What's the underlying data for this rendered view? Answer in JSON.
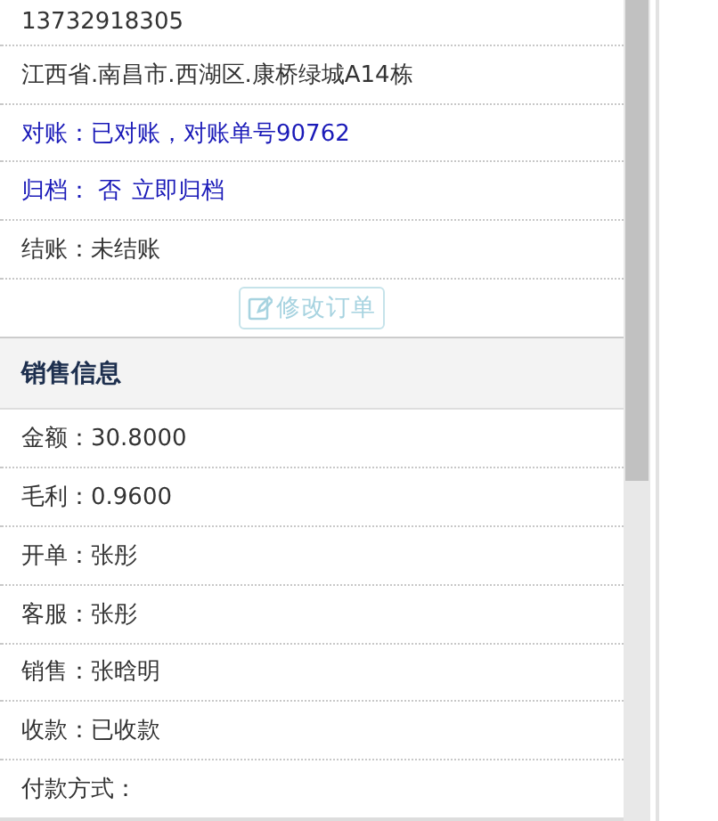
{
  "order_rows": [
    {
      "kind": "plain",
      "text": "13732918305"
    },
    {
      "kind": "plain",
      "text": "江西省.南昌市.西湖区.康桥绿城A14栋"
    },
    {
      "kind": "blue",
      "text": "对账：已对账，对账单号90762"
    },
    {
      "kind": "blue",
      "text": "归档： 否",
      "link": "立即归档"
    },
    {
      "kind": "plain",
      "text": "结账：未结账"
    }
  ],
  "edit_button": {
    "label": "修改订单",
    "disabled": true
  },
  "sales_section": {
    "title": "销售信息",
    "rows": [
      {
        "text": "金额：30.8000"
      },
      {
        "text": "毛利：0.9600"
      },
      {
        "text": "开单：张彤"
      },
      {
        "text": "客服：张彤"
      },
      {
        "text": "销售：张晗明"
      },
      {
        "text": "收款：已收款"
      },
      {
        "text": "付款方式："
      }
    ]
  }
}
